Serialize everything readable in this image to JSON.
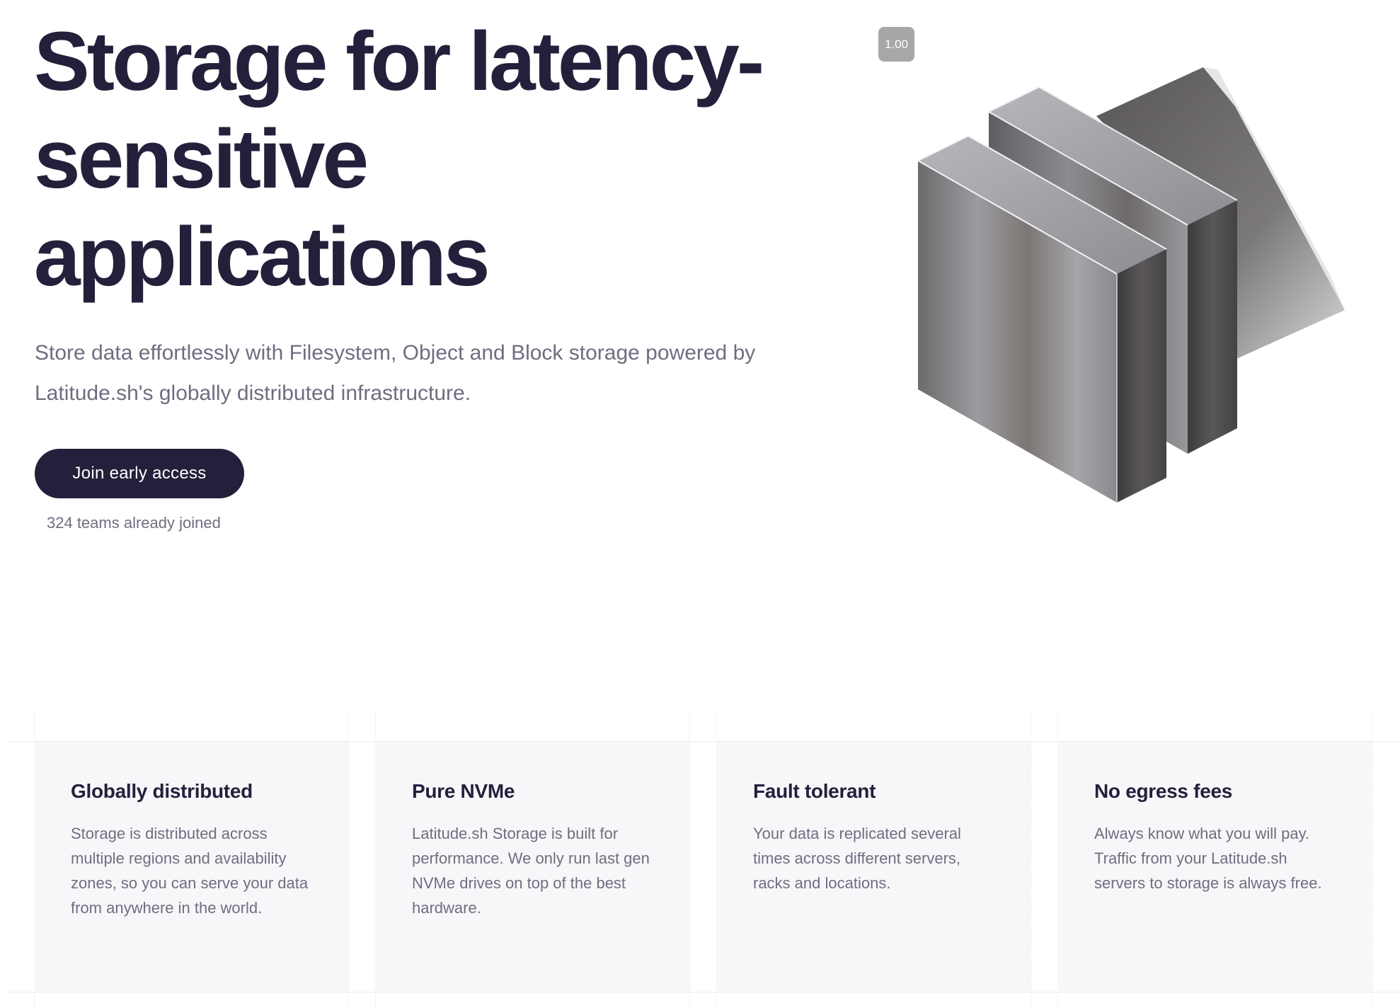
{
  "hero": {
    "title_lines": [
      "Storage for latency-",
      "sensitive",
      "applications"
    ],
    "subtitle": "Store data effortlessly with Filesystem, Object and Block storage powered by Latitude.sh's globally distributed infrastructure.",
    "cta_label": "Join early access",
    "social_proof": "324 teams already joined",
    "art_icon": "stacked-metal-storage-blocks"
  },
  "badge": {
    "label": "1.00"
  },
  "features": [
    {
      "title": "Globally distributed",
      "text": "Storage is distributed across multiple regions and availability zones, so you can serve your data from anywhere in the world."
    },
    {
      "title": "Pure NVMe",
      "text": "Latitude.sh Storage is built for performance. We only run last gen NVMe drives on top of the best hardware."
    },
    {
      "title": "Fault tolerant",
      "text": "Your data is replicated several times across different servers, racks and locations."
    },
    {
      "title": "No egress fees",
      "text": "Always know what you will pay. Traffic from your Latitude.sh servers to storage is always free."
    }
  ],
  "colors": {
    "ink": "#251f3b",
    "muted_text": "#6e6e80",
    "card_bg": "#f7f7f9",
    "badge_bg": "#a7a7a7"
  }
}
